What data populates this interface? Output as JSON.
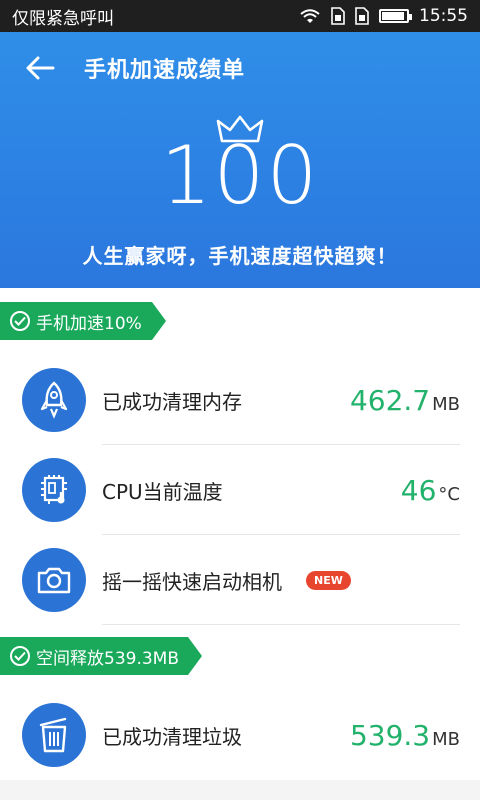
{
  "status_bar": {
    "carrier": "仅限紧急呼叫",
    "time": "15:55"
  },
  "header": {
    "title": "手机加速成绩单",
    "score": "100",
    "slogan": "人生赢家呀，手机速度超快超爽！"
  },
  "sections": [
    {
      "tag": "手机加速10%"
    },
    {
      "tag": "空间释放539.3MB"
    }
  ],
  "rows": {
    "memory": {
      "label": "已成功清理内存",
      "value": "462.7",
      "unit": "MB",
      "icon": "rocket-icon"
    },
    "cpu": {
      "label": "CPU当前温度",
      "value": "46",
      "unit": "°C",
      "icon": "cpu-temperature-icon"
    },
    "camera": {
      "label": "摇一摇快速启动相机",
      "badge": "NEW",
      "icon": "camera-icon"
    },
    "trash": {
      "label": "已成功清理垃圾",
      "value": "539.3",
      "unit": "MB",
      "icon": "trash-icon"
    }
  },
  "colors": {
    "header_blue": "#2b77de",
    "accent_green": "#1aa95b",
    "value_green": "#22b26b",
    "icon_blue": "#2b74d6",
    "badge_red": "#e8452f"
  }
}
